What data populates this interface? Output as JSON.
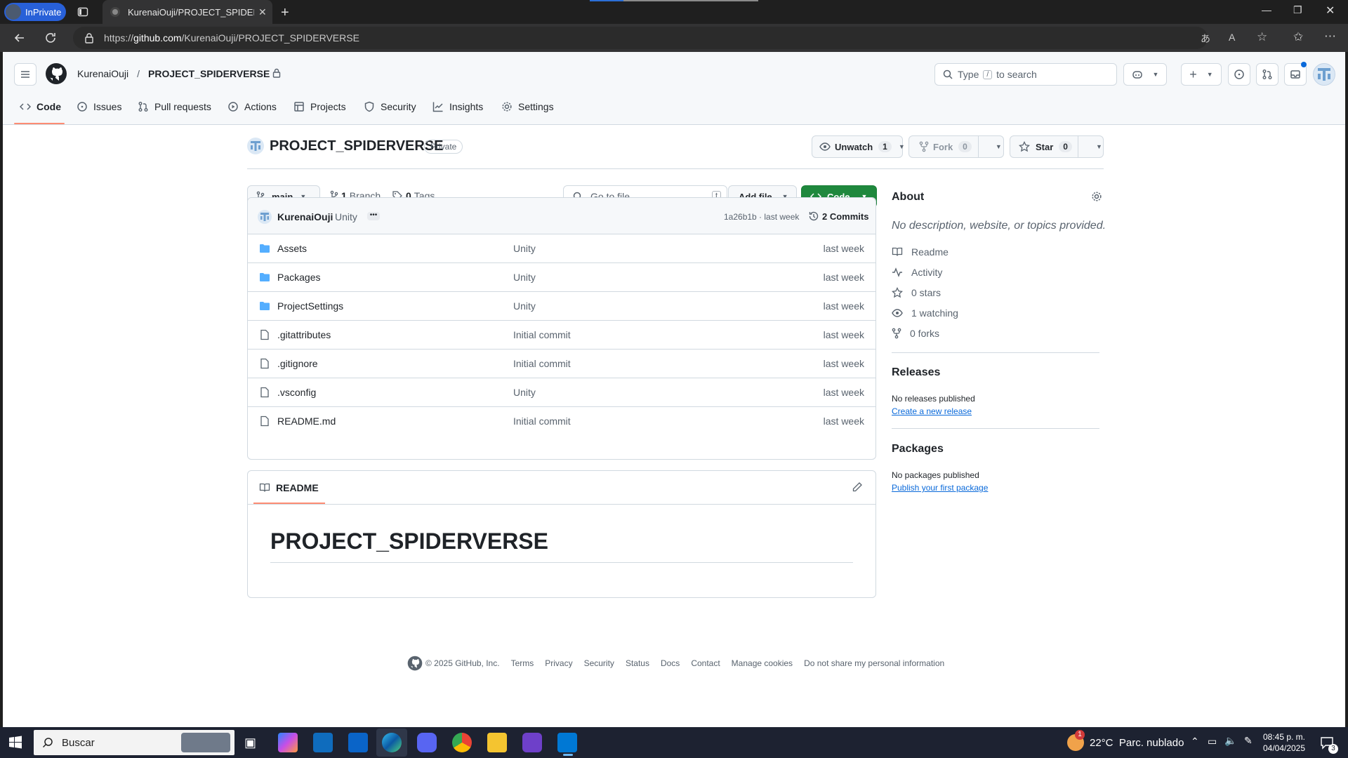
{
  "browser": {
    "inprivate": "InPrivate",
    "tab_title": "KurenaiOuji/PROJECT_SPIDERVERSE",
    "url_prefix": "https://",
    "url_host": "github.com",
    "url_path": "/KurenaiOuji/PROJECT_SPIDERVERSE"
  },
  "header": {
    "owner": "KurenaiOuji",
    "separator": "/",
    "repo": "PROJECT_SPIDERVERSE",
    "search_prefix": "Type",
    "search_key": "/",
    "search_suffix": "to search"
  },
  "nav": [
    "Code",
    "Issues",
    "Pull requests",
    "Actions",
    "Projects",
    "Security",
    "Insights",
    "Settings"
  ],
  "repo": {
    "name": "PROJECT_SPIDERVERSE",
    "visibility": "Private",
    "unwatch": "Unwatch",
    "watch_count": "1",
    "fork": "Fork",
    "fork_count": "0",
    "star": "Star",
    "star_count": "0"
  },
  "toolbar": {
    "branch": "main",
    "branches_count": "1",
    "branches_label": "Branch",
    "tags_count": "0",
    "tags_label": "Tags",
    "goto_placeholder": "Go to file",
    "goto_key": "t",
    "add_file": "Add file",
    "code": "Code"
  },
  "commit": {
    "author": "KurenaiOuji",
    "message": "Unity",
    "hash_time": "1a26b1b · last week",
    "commits": "2 Commits"
  },
  "files": [
    {
      "name": "Assets",
      "type": "folder",
      "message": "Unity",
      "date": "last week"
    },
    {
      "name": "Packages",
      "type": "folder",
      "message": "Unity",
      "date": "last week"
    },
    {
      "name": "ProjectSettings",
      "type": "folder",
      "message": "Unity",
      "date": "last week"
    },
    {
      "name": ".gitattributes",
      "type": "file",
      "message": "Initial commit",
      "date": "last week"
    },
    {
      "name": ".gitignore",
      "type": "file",
      "message": "Initial commit",
      "date": "last week"
    },
    {
      "name": ".vsconfig",
      "type": "file",
      "message": "Unity",
      "date": "last week"
    },
    {
      "name": "README.md",
      "type": "file",
      "message": "Initial commit",
      "date": "last week"
    }
  ],
  "readme": {
    "tab": "README",
    "heading": "PROJECT_SPIDERVERSE"
  },
  "about": {
    "title": "About",
    "description": "No description, website, or topics provided.",
    "items": [
      "Readme",
      "Activity",
      "0 stars",
      "1 watching",
      "0 forks"
    ],
    "releases_title": "Releases",
    "releases_text": "No releases published",
    "releases_link": "Create a new release",
    "packages_title": "Packages",
    "packages_text": "No packages published",
    "packages_link": "Publish your first package"
  },
  "footer": {
    "copyright": "© 2025 GitHub, Inc.",
    "links": [
      "Terms",
      "Privacy",
      "Security",
      "Status",
      "Docs",
      "Contact",
      "Manage cookies",
      "Do not share my personal information"
    ]
  },
  "taskbar": {
    "search": "Buscar",
    "weather": "22°C  Parc. nublado",
    "time": "08:45 p. m.",
    "date": "04/04/2025",
    "notifications": "3",
    "weather_badge": "1"
  },
  "colors": {
    "accent_green": "#1f883d",
    "link_blue": "#0969da",
    "folder_blue": "#54aeff",
    "active_tab_underline": "#fd8c73"
  }
}
